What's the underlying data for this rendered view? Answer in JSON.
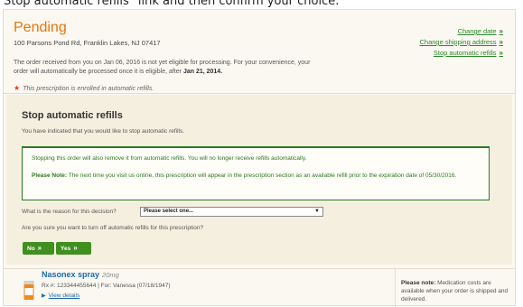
{
  "banner": "Stop automatic refills\" link and then confirm your choice.",
  "order": {
    "status": "Pending",
    "address": "100 Parsons Pond Rd, Franklin Lakes, NJ 07417",
    "note_prefix": "The order received from you on Jan 06, 2016 is not yet eligible for processing. For your convenience, your order will automatically be processed once it is eligible, after ",
    "note_date": "Jan 21, 2014.",
    "enrolled": "This prescription is enrolled in automatic refills."
  },
  "side_links": [
    {
      "label": "Change date",
      "arrow": "»"
    },
    {
      "label": "Change shipping address",
      "arrow": "»"
    },
    {
      "label": "Stop automatic refills",
      "arrow": "»"
    }
  ],
  "stop": {
    "title": "Stop automatic refills",
    "intro": "You have indicated that you would like to stop automatic refills.",
    "alert_line1": "Stopping this order will also remove it from automatic refills. You will no longer receive refills automatically.",
    "alert_note_label": "Please Note:",
    "alert_note_text": " The next time you visit us online, this prescription will appear in the prescription section as an available refill prior to the expiration date of 05/30/2016.",
    "reason_label": "What is the reason for this decision?",
    "reason_value": "Please select one...",
    "confirm_question": "Are you sure you want to turn off automatic refills for this prescription?",
    "no_label": "No",
    "yes_label": "Yes",
    "btn_arrow": "»"
  },
  "rx": {
    "name": "Nasonex spray",
    "strength": "20mg",
    "info": "Rx #: 123344455644 | For: Vanessa (07/18/1947)",
    "details_link": "View details"
  },
  "cost": {
    "label": "Please note:",
    "text": " Medication costs are available when your order is shipped and delivered."
  },
  "colors": {
    "accent": "#e8740a",
    "green": "#3f8f21",
    "link_blue": "#1a6aa8"
  }
}
